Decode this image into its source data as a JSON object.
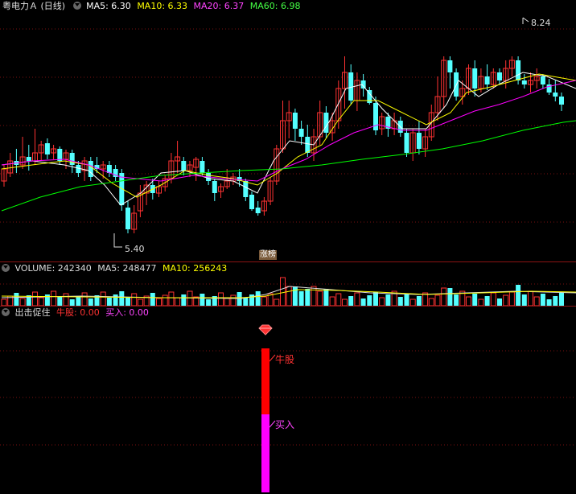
{
  "main_header": {
    "title": "粤电力Ａ (日线)",
    "ma5": "MA5: 6.30",
    "ma10": "MA10: 6.33",
    "ma20": "MA20: 6.37",
    "ma60": "MA60: 6.98"
  },
  "annotations": {
    "high_label": "8.24",
    "low_label": "5.40",
    "event_tag": "涨榜"
  },
  "volume_header": {
    "volume": "VOLUME: 242340",
    "ma5": "MA5: 248477",
    "ma10": "MA10: 256243"
  },
  "indicator_header": {
    "name": "出击促住",
    "niugu": "牛股: 0.00",
    "mairu": "买入: 0.00"
  },
  "indicator_labels": {
    "niugu": "牛股",
    "mairu": "买入"
  },
  "colors": {
    "up": "#ff3232",
    "down": "#54ffff",
    "ma5": "#ffffff",
    "ma10": "#ffff00",
    "ma20": "#ff00ff",
    "ma60": "#00ff00",
    "niugu_bar": "#ff0000",
    "mairu_bar": "#ff00ff",
    "diamond": "diamond-icon"
  }
}
